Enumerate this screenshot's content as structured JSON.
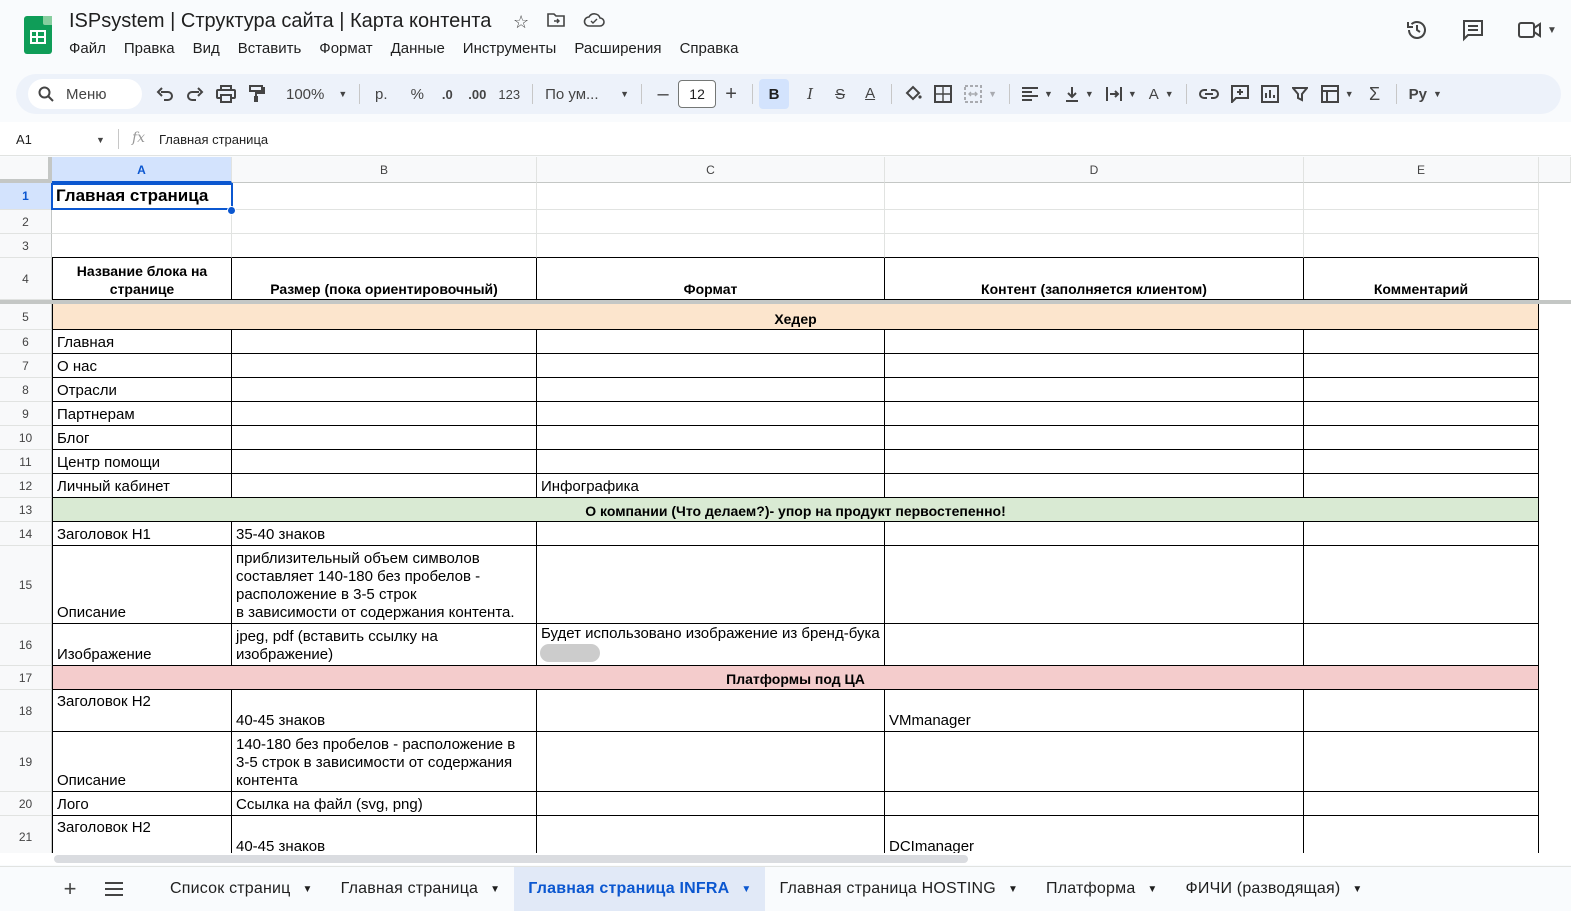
{
  "doc": {
    "title": "ISPsystem | Структура сайта | Карта контента",
    "menu": [
      "Файл",
      "Правка",
      "Вид",
      "Вставить",
      "Формат",
      "Данные",
      "Инструменты",
      "Расширения",
      "Справка"
    ]
  },
  "toolbar": {
    "search_label": "Меню",
    "zoom": "100%",
    "currency": "р.",
    "percent": "%",
    "dec_decrease": ".0",
    "dec_increase": ".00",
    "number_format": "123",
    "font": "По ум...",
    "font_size": "12",
    "bold": "B",
    "italic": "I",
    "currency_right": "Py"
  },
  "formula_bar": {
    "cell_ref": "A1",
    "fx": "fx",
    "content": "Главная страница"
  },
  "columns": [
    "A",
    "B",
    "C",
    "D",
    "E"
  ],
  "rows": [
    "1",
    "2",
    "3",
    "4",
    "5",
    "6",
    "7",
    "8",
    "9",
    "10",
    "11",
    "12",
    "13",
    "14",
    "15",
    "16",
    "17",
    "18",
    "19",
    "20",
    "21"
  ],
  "cells": {
    "r1": {
      "a": "Главная страница"
    },
    "r4": {
      "a": "Название блока на странице",
      "b": "Размер (пока ориентировочный)",
      "c": "Формат",
      "d": "Контент (заполняется клиентом)",
      "e": "Комментарий"
    },
    "r5": {
      "band": "Хедер"
    },
    "r6": {
      "a": "Главная"
    },
    "r7": {
      "a": "О нас"
    },
    "r8": {
      "a": "Отрасли"
    },
    "r9": {
      "a": "Партнерам"
    },
    "r10": {
      "a": "Блог"
    },
    "r11": {
      "a": "Центр помощи"
    },
    "r12": {
      "a": "Личный кабинет",
      "c": "Инфографика"
    },
    "r13": {
      "band": "О компании (Что делаем?)- упор на продукт первостепенно!"
    },
    "r14": {
      "a": "Заголовок H1",
      "b": "35-40 знаков"
    },
    "r15": {
      "a": "Описание",
      "b": "приблизительный объем символов составляет 140-180 без пробелов - расположение в 3-5 строк\nв зависимости от содержания контента."
    },
    "r16": {
      "a": "Изображение",
      "b": "jpeg, pdf (вставить ссылку на изображение)",
      "c": "Будет использовано изображение из бренд-бука"
    },
    "r17": {
      "band": "Платформы под ЦА"
    },
    "r18": {
      "a": "Заголовок H2",
      "b": "40-45 знаков",
      "d": "VMmanager"
    },
    "r19": {
      "a": "Описание",
      "b": "140-180 без пробелов - расположение в 3-5 строк в зависимости от содержания контента"
    },
    "r20": {
      "a": "Лого",
      "b": "Ссылка на файл (svg, png)"
    },
    "r21": {
      "a": "Заголовок H2",
      "b": "40-45 знаков",
      "d": "DCImanager"
    }
  },
  "colors": {
    "band_header": "#fce5cd",
    "band_about": "#d9ead3",
    "band_platforms": "#f4cccc",
    "accent": "#0b57d0"
  },
  "tabs": [
    "Список страниц",
    "Главная страница",
    "Главная страница INFRA",
    "Главная страница HOSTING",
    "Платформа",
    "ФИЧИ (разводящая)"
  ],
  "active_tab": "Главная страница INFRA"
}
